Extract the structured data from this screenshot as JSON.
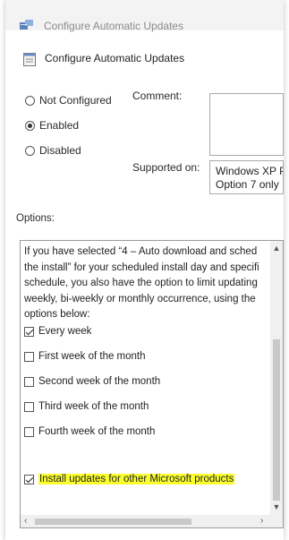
{
  "window": {
    "title": "Configure Automatic Updates",
    "icon": "group-policy-icon"
  },
  "header": {
    "title": "Configure Automatic Updates",
    "icon": "policy-setting-icon"
  },
  "state_options": [
    {
      "label": "Not Configured",
      "checked": false
    },
    {
      "label": "Enabled",
      "checked": true
    },
    {
      "label": "Disabled",
      "checked": false
    }
  ],
  "comment": {
    "label": "Comment:",
    "value": ""
  },
  "supported": {
    "label": "Supported on:",
    "lines": [
      "Windows XP P",
      "Option 7 only"
    ]
  },
  "options": {
    "label": "Options:",
    "description_lines": [
      "If you have selected “4 – Auto download and sched",
      "the install” for your scheduled install day and specifi",
      "schedule, you also have the option to limit updating",
      "weekly, bi-weekly or monthly occurrence, using the",
      "options below:"
    ],
    "checkboxes": [
      {
        "label": "Every week",
        "checked": true,
        "highlighted": false
      },
      {
        "label": "First week of the month",
        "checked": false,
        "highlighted": false
      },
      {
        "label": "Second week of the month",
        "checked": false,
        "highlighted": false
      },
      {
        "label": "Third week of the month",
        "checked": false,
        "highlighted": false
      },
      {
        "label": "Fourth week of the month",
        "checked": false,
        "highlighted": false
      },
      {
        "label": "Install updates for other Microsoft products",
        "checked": true,
        "highlighted": true
      }
    ]
  },
  "colors": {
    "highlight": "#fbff2e"
  }
}
